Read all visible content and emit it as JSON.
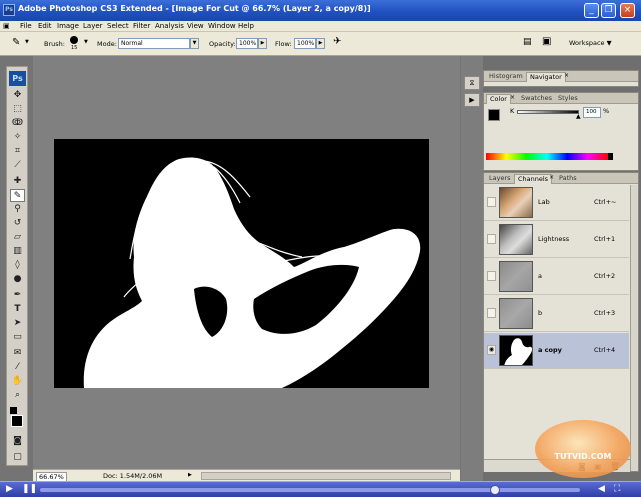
{
  "window": {
    "title": "Adobe Photoshop CS3 Extended - [Image For Cut @ 66.7% (Layer 2, a copy/8)]",
    "app_icon": "Ps",
    "controls": [
      "minimize-icon",
      "restore-icon",
      "close-icon"
    ]
  },
  "menu": [
    "File",
    "Edit",
    "Image",
    "Layer",
    "Select",
    "Filter",
    "Analysis",
    "View",
    "Window",
    "Help"
  ],
  "options": {
    "brush_label": "Brush:",
    "brush_size": "15",
    "mode_label": "Mode:",
    "mode_value": "Normal",
    "opacity_label": "Opacity:",
    "opacity_value": "100%",
    "flow_label": "Flow:",
    "flow_value": "100%",
    "workspace_label": "Workspace ▼"
  },
  "toolbox": {
    "logo": "Ps",
    "tools": [
      "move-icon",
      "marquee-icon",
      "lasso-icon",
      "magic-wand-icon",
      "crop-icon",
      "slice-icon",
      "healing-brush-icon",
      "brush-icon",
      "clone-stamp-icon",
      "history-brush-icon",
      "eraser-icon",
      "gradient-icon",
      "blur-icon",
      "dodge-icon",
      "pen-icon",
      "type-icon",
      "path-selection-icon",
      "shape-icon",
      "notes-icon",
      "eyedropper-icon",
      "hand-icon",
      "zoom-icon"
    ]
  },
  "status": {
    "zoom": "66.67%",
    "doc": "Doc: 1.54M/2.06M"
  },
  "panels": {
    "nav_tabs": [
      "Histogram",
      "Navigator"
    ],
    "color_tabs": [
      "Color",
      "Swatches",
      "Styles"
    ],
    "color_slider_label": "K",
    "color_value": "100",
    "color_unit": "%",
    "layer_tabs": [
      "Layers",
      "Channels",
      "Paths"
    ]
  },
  "channels": [
    {
      "name": "Lab",
      "shortcut": "Ctrl+~",
      "visible": false,
      "selected": false
    },
    {
      "name": "Lightness",
      "shortcut": "Ctrl+1",
      "visible": false,
      "selected": false
    },
    {
      "name": "a",
      "shortcut": "Ctrl+2",
      "visible": false,
      "selected": false
    },
    {
      "name": "b",
      "shortcut": "Ctrl+3",
      "visible": false,
      "selected": false
    },
    {
      "name": "a copy",
      "shortcut": "Ctrl+4",
      "visible": true,
      "selected": true
    }
  ],
  "watermark": "TUTVID.COM",
  "colors": {
    "title_bar": "#1f4fbf",
    "menu_bg": "#ece9d8",
    "workspace": "#808080",
    "selected_row": "#b9c2d6"
  }
}
